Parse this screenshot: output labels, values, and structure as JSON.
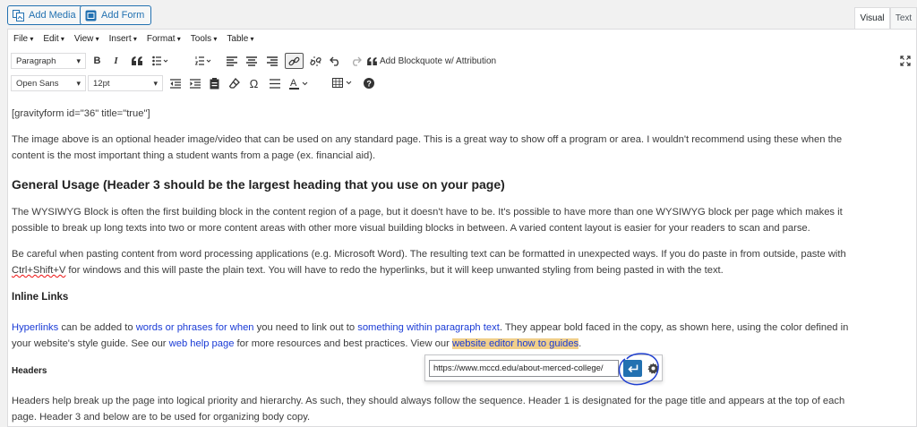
{
  "media": {
    "add_media": "Add Media",
    "add_form": "Add Form"
  },
  "tabs": {
    "visual": "Visual",
    "text": "Text"
  },
  "menu": [
    "File",
    "Edit",
    "View",
    "Insert",
    "Format",
    "Tools",
    "Table"
  ],
  "toolbar1": {
    "format_select": "Paragraph",
    "bold": "B",
    "italic": "I",
    "quote": "66",
    "add_blockquote": "Add Blockquote w/ Attribution"
  },
  "toolbar2": {
    "font_family": "Open Sans",
    "font_size": "12pt",
    "omega": "Ω"
  },
  "content": {
    "shortcode": "[gravityform id=\"36\" title=\"true\"]",
    "intro_line1": "The image above is an optional header image/video that can be used on any standard page. This is a great way to show off a program or area. I wouldn't recommend using these when the",
    "intro_line2": "content is the most important thing a student wants from a page (ex. financial aid).",
    "heading_general": "General Usage (Header 3 should be the largest heading that you use on your page)",
    "wysiwyg_line1": "The WYSIWYG Block is often the first building block in the content region of a page, but it doesn't have to be. It's possible to have more than one WYSIWYG block per page which makes it",
    "wysiwyg_line2": "possible to break up long texts into two or more content areas with other more visual building blocks in between. A varied content layout is easier for your readers to scan and parse.",
    "paste_line1": "Be careful when pasting content from word processing applications (e.g. Microsoft Word). The resulting text can be formatted in unexpected ways. If you do paste in from outside, paste with",
    "paste_line2a": "Ctrl+Shift+V",
    "paste_line2b": " for windows and this will paste the plain text. You will have to redo the hyperlinks, but it will keep unwanted styling from being pasted in with the text.",
    "heading_inline": "Inline Links",
    "links_line1": {
      "a": "Hyperlinks",
      "b": " can be added to ",
      "c": "words or phrases for when",
      "d": " you need to link out to ",
      "e": "something within paragraph text",
      "f": ". They appear bold faced in the copy, as shown here, using the color defined in"
    },
    "links_line2": {
      "a": "your website's style guide. See our ",
      "b": "web help page",
      "c": " for more resources and best practices. View our ",
      "d": "website editor how to guides",
      "e": "."
    },
    "heading_headers": "Headers",
    "headers_line1": "Headers help break up the page into logical priority and hierarchy. As such, they should always follow the sequence. Header 1 is designated for the page title and appears at the top of each",
    "headers_line2": "page. Header 3 and below are to be used for organizing body copy."
  },
  "link_popup": {
    "url": "https://www.mccd.edu/about-merced-college/"
  },
  "colors": {
    "accent": "#2271b1",
    "link": "#1a3bd6",
    "highlight": "#f1cf8a"
  }
}
